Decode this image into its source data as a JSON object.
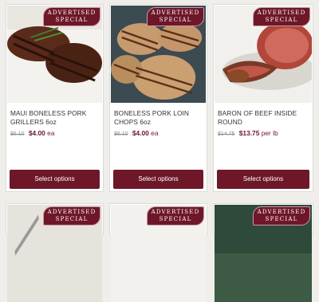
{
  "products": [
    {
      "name": "MAUI BONELESS PORK GRILLERS 6oz",
      "old_price": "$6.10",
      "new_price": "$4.00",
      "unit": "ea",
      "badge_line1": "ADVERTISED",
      "badge_line2": "SPECIAL",
      "button": "Select options"
    },
    {
      "name": "BONELESS PORK LOIN CHOPS 6oz",
      "old_price": "$6.10",
      "new_price": "$4.00",
      "unit": "ea",
      "badge_line1": "ADVERTISED",
      "badge_line2": "SPECIAL",
      "button": "Select options"
    },
    {
      "name": "BARON OF BEEF INSIDE ROUND",
      "old_price": "$14.75",
      "new_price": "$13.75",
      "unit": "per lb",
      "badge_line1": "ADVERTISED",
      "badge_line2": "SPECIAL",
      "button": "Select options"
    }
  ],
  "next_row_badges": [
    {
      "line1": "ADVERTISED",
      "line2": "SPECIAL"
    },
    {
      "line1": "ADVERTISED",
      "line2": "SPECIAL"
    },
    {
      "line1": "ADVERTISED",
      "line2": "SPECIAL"
    }
  ],
  "colors": {
    "accent": "#6e1729",
    "page_background": "#efeeea",
    "card_background": "#ffffff"
  }
}
